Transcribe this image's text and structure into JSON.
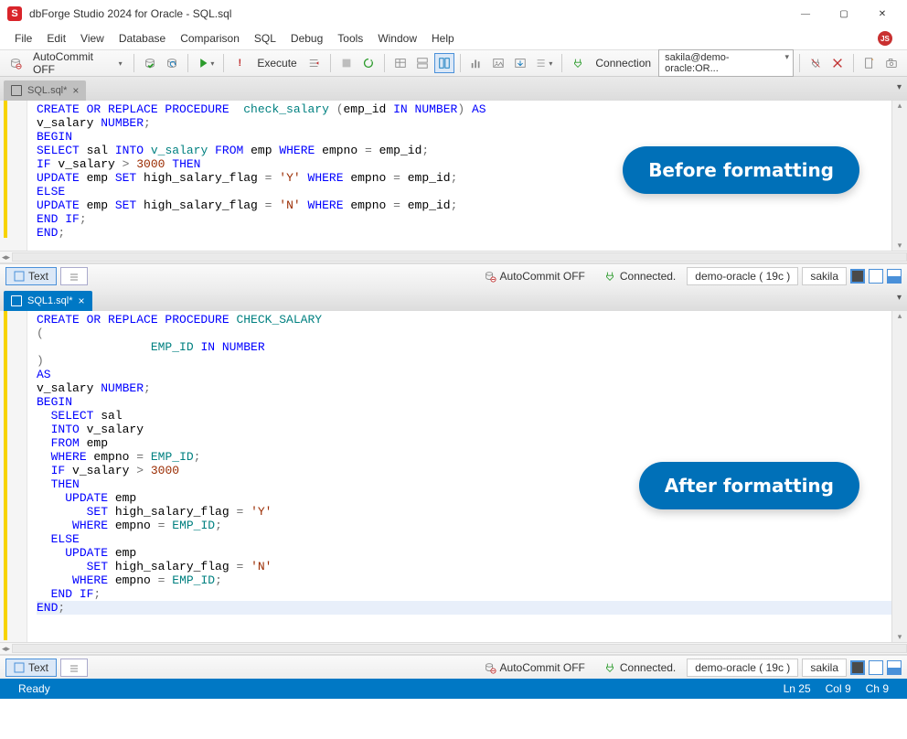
{
  "window": {
    "title": "dbForge Studio 2024 for Oracle - SQL.sql"
  },
  "menubar": {
    "file": "File",
    "edit": "Edit",
    "view": "View",
    "database": "Database",
    "comparison": "Comparison",
    "sql": "SQL",
    "debug": "Debug",
    "tools": "Tools",
    "window": "Window",
    "help": "Help"
  },
  "toolbar": {
    "autocommit": "AutoCommit OFF",
    "execute": "Execute",
    "connection_label": "Connection",
    "connection_value": "sakila@demo-oracle:OR..."
  },
  "tabs": {
    "tab1": "SQL.sql*",
    "tab2": "SQL1.sql*"
  },
  "callouts": {
    "before": "Before formatting",
    "after": "After formatting"
  },
  "editor1": {
    "lines": [
      {
        "seg": [
          [
            "kw",
            "CREATE OR REPLACE PROCEDURE"
          ],
          [
            "",
            "  "
          ],
          [
            "id",
            "check_salary"
          ],
          [
            "",
            " "
          ],
          [
            "op",
            "("
          ],
          [
            "",
            "emp_id "
          ],
          [
            "kw",
            "IN NUMBER"
          ],
          [
            "op",
            ")"
          ],
          [
            "",
            " "
          ],
          [
            "kw",
            "AS"
          ]
        ]
      },
      {
        "seg": [
          [
            "",
            "v_salary "
          ],
          [
            "kw",
            "NUMBER"
          ],
          [
            "op",
            ";"
          ]
        ]
      },
      {
        "seg": [
          [
            "kw",
            "BEGIN"
          ]
        ]
      },
      {
        "seg": [
          [
            "kw",
            "SELECT"
          ],
          [
            "",
            " sal "
          ],
          [
            "kw",
            "INTO"
          ],
          [
            "",
            " "
          ],
          [
            "id",
            "v_salary"
          ],
          [
            "",
            " "
          ],
          [
            "kw",
            "FROM"
          ],
          [
            "",
            " emp "
          ],
          [
            "kw",
            "WHERE"
          ],
          [
            "",
            " empno "
          ],
          [
            "op",
            "="
          ],
          [
            "",
            " emp_id"
          ],
          [
            "op",
            ";"
          ]
        ]
      },
      {
        "seg": [
          [
            "kw",
            "IF"
          ],
          [
            "",
            " v_salary "
          ],
          [
            "op",
            ">"
          ],
          [
            "",
            " "
          ],
          [
            "num",
            "3000"
          ],
          [
            "",
            " "
          ],
          [
            "kw",
            "THEN"
          ]
        ]
      },
      {
        "seg": [
          [
            "kw",
            "UPDATE"
          ],
          [
            "",
            " emp "
          ],
          [
            "kw",
            "SET"
          ],
          [
            "",
            " high_salary_flag "
          ],
          [
            "op",
            "="
          ],
          [
            "",
            " "
          ],
          [
            "str",
            "'Y'"
          ],
          [
            "",
            " "
          ],
          [
            "kw",
            "WHERE"
          ],
          [
            "",
            " empno "
          ],
          [
            "op",
            "="
          ],
          [
            "",
            " emp_id"
          ],
          [
            "op",
            ";"
          ]
        ]
      },
      {
        "seg": [
          [
            "kw",
            "ELSE"
          ]
        ]
      },
      {
        "seg": [
          [
            "kw",
            "UPDATE"
          ],
          [
            "",
            " emp "
          ],
          [
            "kw",
            "SET"
          ],
          [
            "",
            " high_salary_flag "
          ],
          [
            "op",
            "="
          ],
          [
            "",
            " "
          ],
          [
            "str",
            "'N'"
          ],
          [
            "",
            " "
          ],
          [
            "kw",
            "WHERE"
          ],
          [
            "",
            " empno "
          ],
          [
            "op",
            "="
          ],
          [
            "",
            " emp_id"
          ],
          [
            "op",
            ";"
          ]
        ]
      },
      {
        "seg": [
          [
            "kw",
            "END IF"
          ],
          [
            "op",
            ";"
          ]
        ]
      },
      {
        "seg": [
          [
            "kw",
            "END"
          ],
          [
            "op",
            ";"
          ]
        ]
      }
    ]
  },
  "editor2": {
    "lines": [
      {
        "seg": [
          [
            "kw",
            "CREATE OR REPLACE PROCEDURE"
          ],
          [
            "",
            " "
          ],
          [
            "id",
            "CHECK_SALARY"
          ]
        ]
      },
      {
        "seg": [
          [
            "op",
            "("
          ]
        ]
      },
      {
        "seg": [
          [
            "",
            "                "
          ],
          [
            "id",
            "EMP_ID"
          ],
          [
            "",
            " "
          ],
          [
            "kw",
            "IN NUMBER"
          ]
        ]
      },
      {
        "seg": [
          [
            "op",
            ")"
          ]
        ]
      },
      {
        "seg": [
          [
            "kw",
            "AS"
          ]
        ]
      },
      {
        "seg": [
          [
            "",
            "v_salary "
          ],
          [
            "kw",
            "NUMBER"
          ],
          [
            "op",
            ";"
          ]
        ]
      },
      {
        "seg": [
          [
            "kw",
            "BEGIN"
          ]
        ]
      },
      {
        "seg": [
          [
            "",
            "  "
          ],
          [
            "kw",
            "SELECT"
          ],
          [
            "",
            " sal"
          ]
        ]
      },
      {
        "seg": [
          [
            "",
            "  "
          ],
          [
            "kw",
            "INTO"
          ],
          [
            "",
            " v_salary"
          ]
        ]
      },
      {
        "seg": [
          [
            "",
            "  "
          ],
          [
            "kw",
            "FROM"
          ],
          [
            "",
            " emp"
          ]
        ]
      },
      {
        "seg": [
          [
            "",
            "  "
          ],
          [
            "kw",
            "WHERE"
          ],
          [
            "",
            " empno "
          ],
          [
            "op",
            "="
          ],
          [
            "",
            " "
          ],
          [
            "id",
            "EMP_ID"
          ],
          [
            "op",
            ";"
          ]
        ]
      },
      {
        "seg": [
          [
            "",
            ""
          ]
        ]
      },
      {
        "seg": [
          [
            "",
            "  "
          ],
          [
            "kw",
            "IF"
          ],
          [
            "",
            " v_salary "
          ],
          [
            "op",
            ">"
          ],
          [
            "",
            " "
          ],
          [
            "num",
            "3000"
          ]
        ]
      },
      {
        "seg": [
          [
            "",
            "  "
          ],
          [
            "kw",
            "THEN"
          ]
        ]
      },
      {
        "seg": [
          [
            "",
            "    "
          ],
          [
            "kw",
            "UPDATE"
          ],
          [
            "",
            " emp"
          ]
        ]
      },
      {
        "seg": [
          [
            "",
            "       "
          ],
          [
            "kw",
            "SET"
          ],
          [
            "",
            " high_salary_flag "
          ],
          [
            "op",
            "="
          ],
          [
            "",
            " "
          ],
          [
            "str",
            "'Y'"
          ]
        ]
      },
      {
        "seg": [
          [
            "",
            "     "
          ],
          [
            "kw",
            "WHERE"
          ],
          [
            "",
            " empno "
          ],
          [
            "op",
            "="
          ],
          [
            "",
            " "
          ],
          [
            "id",
            "EMP_ID"
          ],
          [
            "op",
            ";"
          ]
        ]
      },
      {
        "seg": [
          [
            "",
            "  "
          ],
          [
            "kw",
            "ELSE"
          ]
        ]
      },
      {
        "seg": [
          [
            "",
            "    "
          ],
          [
            "kw",
            "UPDATE"
          ],
          [
            "",
            " emp"
          ]
        ]
      },
      {
        "seg": [
          [
            "",
            "       "
          ],
          [
            "kw",
            "SET"
          ],
          [
            "",
            " high_salary_flag "
          ],
          [
            "op",
            "="
          ],
          [
            "",
            " "
          ],
          [
            "str",
            "'N'"
          ]
        ]
      },
      {
        "seg": [
          [
            "",
            "     "
          ],
          [
            "kw",
            "WHERE"
          ],
          [
            "",
            " empno "
          ],
          [
            "op",
            "="
          ],
          [
            "",
            " "
          ],
          [
            "id",
            "EMP_ID"
          ],
          [
            "op",
            ";"
          ]
        ]
      },
      {
        "seg": [
          [
            "",
            "  "
          ],
          [
            "kw",
            "END IF"
          ],
          [
            "op",
            ";"
          ]
        ]
      },
      {
        "seg": [
          [
            "",
            ""
          ]
        ]
      },
      {
        "seg": [
          [
            "kw",
            "END"
          ],
          [
            "op",
            ";"
          ]
        ],
        "cursor": true
      }
    ]
  },
  "editstatus": {
    "text_btn": "Text",
    "autocommit": "AutoCommit OFF",
    "connected": "Connected.",
    "server": "demo-oracle ( 19c )",
    "schema": "sakila"
  },
  "appstatus": {
    "ready": "Ready",
    "ln": "Ln 25",
    "col": "Col 9",
    "ch": "Ch 9"
  }
}
